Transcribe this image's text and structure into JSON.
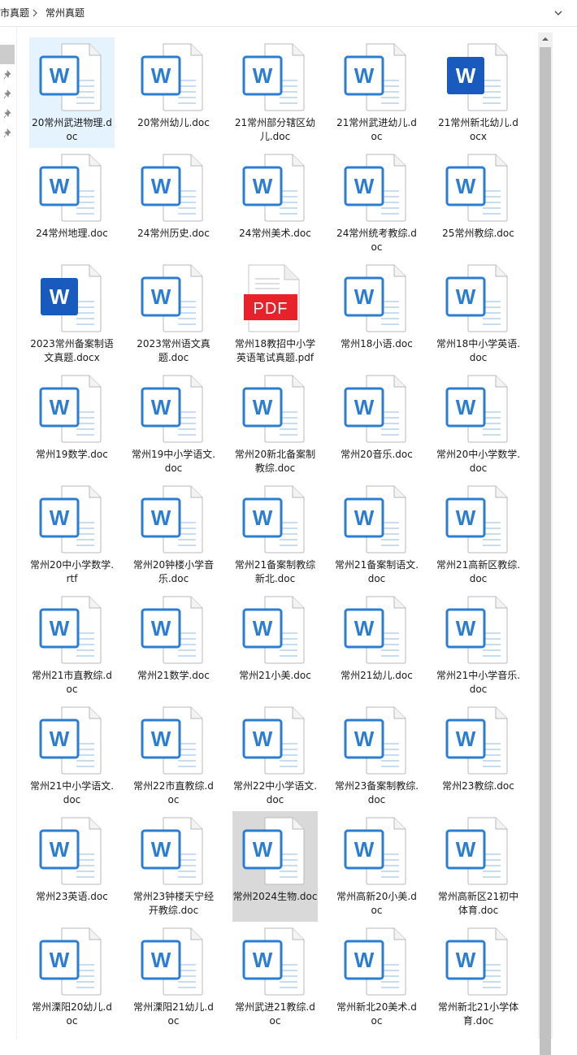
{
  "breadcrumb": {
    "parent": "市真题",
    "current": "常州真题"
  },
  "files": [
    {
      "name": "20常州武进物理.doc",
      "type": "doc"
    },
    {
      "name": "20常州幼儿.doc",
      "type": "doc"
    },
    {
      "name": "21常州部分辖区幼儿.doc",
      "type": "doc"
    },
    {
      "name": "21常州武进幼儿.doc",
      "type": "doc"
    },
    {
      "name": "21常州新北幼儿.docx",
      "type": "docx"
    },
    {
      "name": "24常州地理.doc",
      "type": "doc"
    },
    {
      "name": "24常州历史.doc",
      "type": "doc"
    },
    {
      "name": "24常州美术.doc",
      "type": "doc"
    },
    {
      "name": "24常州统考教综.doc",
      "type": "doc"
    },
    {
      "name": "25常州教综.doc",
      "type": "doc"
    },
    {
      "name": "2023常州备案制语文真题.docx",
      "type": "docx"
    },
    {
      "name": "2023常州语文真题.doc",
      "type": "doc"
    },
    {
      "name": "常州18教招中小学英语笔试真题.pdf",
      "type": "pdf"
    },
    {
      "name": "常州18小语.doc",
      "type": "doc"
    },
    {
      "name": "常州18中小学英语.doc",
      "type": "doc"
    },
    {
      "name": "常州19数学.doc",
      "type": "doc"
    },
    {
      "name": "常州19中小学语文.doc",
      "type": "doc"
    },
    {
      "name": "常州20新北备案制教综.doc",
      "type": "doc"
    },
    {
      "name": "常州20音乐.doc",
      "type": "doc"
    },
    {
      "name": "常州20中小学数学.doc",
      "type": "doc"
    },
    {
      "name": "常州20中小学数学.rtf",
      "type": "doc"
    },
    {
      "name": "常州20钟楼小学音乐.doc",
      "type": "doc"
    },
    {
      "name": "常州21备案制教综新北.doc",
      "type": "doc"
    },
    {
      "name": "常州21备案制语文.doc",
      "type": "doc"
    },
    {
      "name": "常州21高新区教综.doc",
      "type": "doc"
    },
    {
      "name": "常州21市直教综.doc",
      "type": "doc"
    },
    {
      "name": "常州21数学.doc",
      "type": "doc"
    },
    {
      "name": "常州21小美.doc",
      "type": "doc"
    },
    {
      "name": "常州21幼儿.doc",
      "type": "doc"
    },
    {
      "name": "常州21中小学音乐.doc",
      "type": "doc"
    },
    {
      "name": "常州21中小学语文.doc",
      "type": "doc"
    },
    {
      "name": "常州22市直教综.doc",
      "type": "doc"
    },
    {
      "name": "常州22中小学语文.doc",
      "type": "doc"
    },
    {
      "name": "常州23备案制教综.doc",
      "type": "doc"
    },
    {
      "name": "常州23教综.doc",
      "type": "doc"
    },
    {
      "name": "常州23英语.doc",
      "type": "doc"
    },
    {
      "name": "常州23钟楼天宁经开教综.doc",
      "type": "doc"
    },
    {
      "name": "常州2024生物.doc",
      "type": "doc"
    },
    {
      "name": "常州高新20小美.doc",
      "type": "doc"
    },
    {
      "name": "常州高新区21初中体育.doc",
      "type": "doc"
    },
    {
      "name": "常州溧阳20幼儿.doc",
      "type": "doc"
    },
    {
      "name": "常州溧阳21幼儿.doc",
      "type": "doc"
    },
    {
      "name": "常州武进21教综.doc",
      "type": "doc"
    },
    {
      "name": "常州新北20美术.doc",
      "type": "doc"
    },
    {
      "name": "常州新北21小学体育.doc",
      "type": "doc"
    }
  ],
  "selection": {
    "selected_index": 0,
    "hover_index": 37
  },
  "icons": {
    "doc_accent": "#2b7cd3",
    "docx_accent": "#185abd",
    "pdf_accent": "#e8222b",
    "pdf_label": "PDF"
  }
}
